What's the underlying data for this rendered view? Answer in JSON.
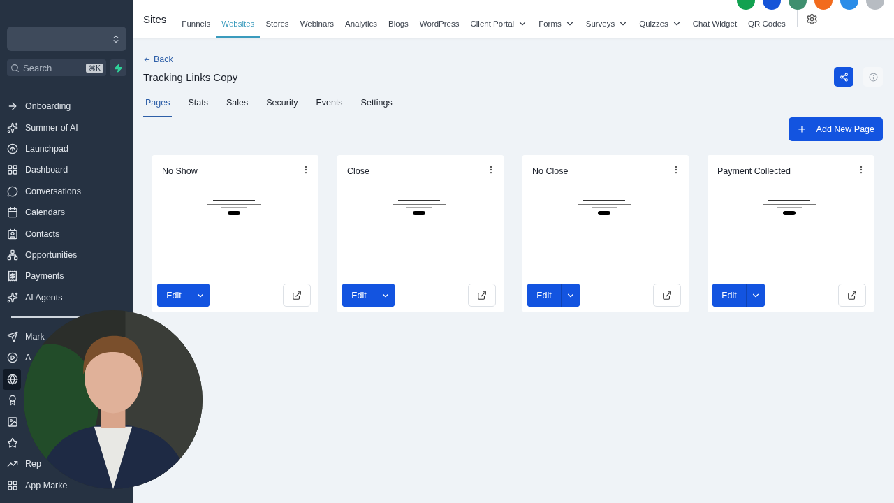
{
  "sidebar": {
    "search": {
      "placeholder": "Search",
      "shortcut": "⌘K"
    },
    "items": [
      {
        "label": "Onboarding",
        "selected": false
      },
      {
        "label": "Summer of AI",
        "selected": false
      },
      {
        "label": "Launchpad",
        "selected": false
      },
      {
        "label": "Dashboard",
        "selected": false
      },
      {
        "label": "Conversations",
        "selected": false
      },
      {
        "label": "Calendars",
        "selected": false
      },
      {
        "label": "Contacts",
        "selected": false
      },
      {
        "label": "Opportunities",
        "selected": false
      },
      {
        "label": "Payments",
        "selected": false
      },
      {
        "label": "AI Agents",
        "selected": false
      }
    ],
    "items_lower": [
      {
        "label": "Mark",
        "selected": false
      },
      {
        "label": "A",
        "selected": false
      },
      {
        "selected": true
      },
      {
        "selected": false
      },
      {
        "selected": false
      },
      {
        "selected": false
      },
      {
        "label": "Rep",
        "selected": false
      },
      {
        "label": "App Marke",
        "selected": false
      }
    ]
  },
  "topbar": {
    "title": "Sites",
    "nav": [
      {
        "label": "Funnels",
        "selected": false,
        "dropdown": false
      },
      {
        "label": "Websites",
        "selected": true,
        "dropdown": false
      },
      {
        "label": "Stores",
        "selected": false,
        "dropdown": false
      },
      {
        "label": "Webinars",
        "selected": false,
        "dropdown": false
      },
      {
        "label": "Analytics",
        "selected": false,
        "dropdown": false
      },
      {
        "label": "Blogs",
        "selected": false,
        "dropdown": false
      },
      {
        "label": "WordPress",
        "selected": false,
        "dropdown": false
      },
      {
        "label": "Client Portal",
        "selected": false,
        "dropdown": true
      },
      {
        "label": "Forms",
        "selected": false,
        "dropdown": true
      },
      {
        "label": "Surveys",
        "selected": false,
        "dropdown": true
      },
      {
        "label": "Quizzes",
        "selected": false,
        "dropdown": true
      },
      {
        "label": "Chat Widget",
        "selected": false,
        "dropdown": false
      },
      {
        "label": "QR Codes",
        "selected": false,
        "dropdown": false
      }
    ],
    "status_dots": [
      {
        "color": "#12a150"
      },
      {
        "color": "#1554d8"
      },
      {
        "color": "#3f8f6f"
      },
      {
        "color": "#f26b1d"
      },
      {
        "color": "#2b8de8"
      }
    ]
  },
  "header": {
    "back": "Back",
    "title": "Tracking Links Copy",
    "tabs": [
      {
        "label": "Pages",
        "selected": true
      },
      {
        "label": "Stats",
        "selected": false
      },
      {
        "label": "Sales",
        "selected": false
      },
      {
        "label": "Security",
        "selected": false
      },
      {
        "label": "Events",
        "selected": false
      },
      {
        "label": "Settings",
        "selected": false
      }
    ],
    "add_button": "Add New Page"
  },
  "pages": [
    {
      "title": "No Show",
      "edit": "Edit"
    },
    {
      "title": "Close",
      "edit": "Edit"
    },
    {
      "title": "No Close",
      "edit": "Edit"
    },
    {
      "title": "Payment Collected",
      "edit": "Edit"
    }
  ]
}
